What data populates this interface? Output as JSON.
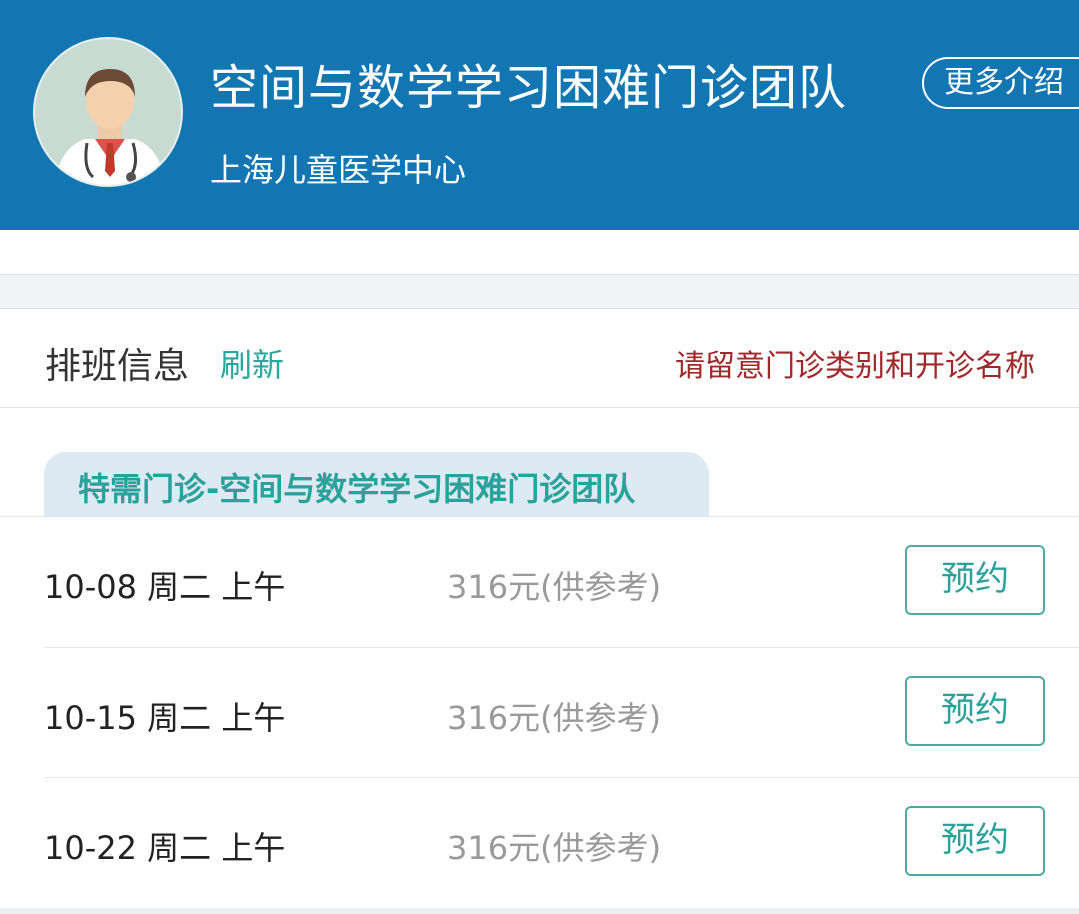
{
  "header": {
    "team_title": "空间与数学学习困难门诊团队",
    "hospital": "上海儿童医学中心",
    "more_button": "更多介绍",
    "avatar_icon": "doctor-avatar-icon"
  },
  "schedule": {
    "title": "排班信息",
    "refresh_label": "刷新",
    "notice": "请留意门诊类别和开诊名称"
  },
  "category": {
    "label": "特需门诊-空间与数学学习困难门诊团队"
  },
  "rows": [
    {
      "date": "10-08 周二 上午",
      "price": "316元(供参考)",
      "button": "预约"
    },
    {
      "date": "10-15 周二 上午",
      "price": "316元(供参考)",
      "button": "预约"
    },
    {
      "date": "10-22 周二 上午",
      "price": "316元(供参考)",
      "button": "预约"
    }
  ],
  "colors": {
    "header_bg": "#1276b3",
    "accent_teal": "#2aa19a",
    "notice_red": "#a0282b"
  }
}
